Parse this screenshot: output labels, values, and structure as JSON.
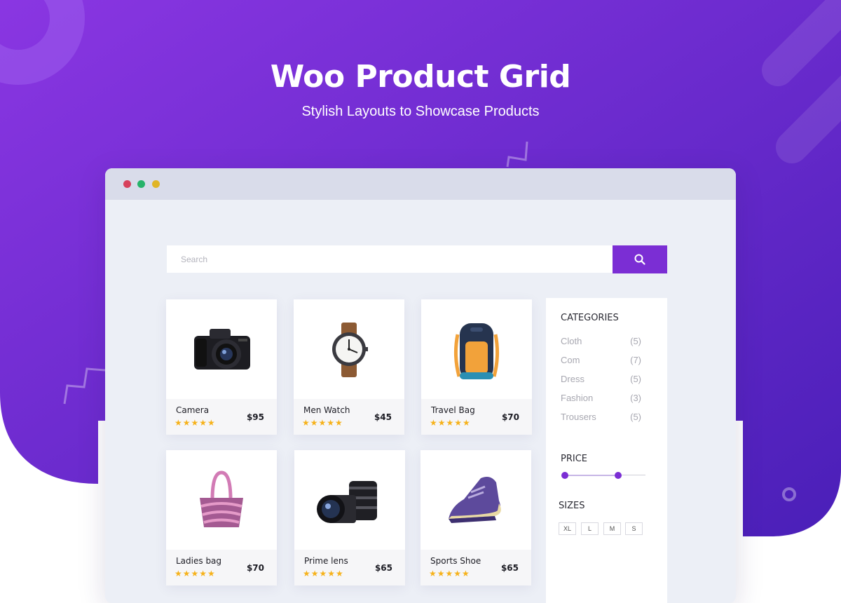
{
  "hero": {
    "title": "Woo Product Grid",
    "subtitle": "Stylish Layouts to Showcase Products"
  },
  "colors": {
    "accent": "#7b2ed4",
    "gradient_start": "#8a36e2",
    "gradient_end": "#4a1fb8",
    "star": "#f6b21b",
    "dot_red": "#d7415c",
    "dot_green": "#27b36a",
    "dot_yellow": "#e0b526"
  },
  "browser": {
    "window_controls": [
      "close-dot",
      "minimize-dot",
      "maximize-dot"
    ]
  },
  "search": {
    "placeholder": "Search",
    "button_icon": "search-icon"
  },
  "products": [
    {
      "name": "Camera",
      "price": "$95",
      "stars": "★★★★★",
      "icon": "camera-image",
      "rating": 5
    },
    {
      "name": "Men Watch",
      "price": "$45",
      "stars": "★★★★★",
      "icon": "watch-image",
      "rating": 5
    },
    {
      "name": "Travel Bag",
      "price": "$70",
      "stars": "★★★★★",
      "icon": "backpack-image",
      "rating": 5
    },
    {
      "name": "Ladies bag",
      "price": "$70",
      "stars": "★★★★★",
      "icon": "handbag-image",
      "rating": 5
    },
    {
      "name": "Prime lens",
      "price": "$65",
      "stars": "★★★★★",
      "icon": "lens-image",
      "rating": 5
    },
    {
      "name": "Sports Shoe",
      "price": "$65",
      "stars": "★★★★★",
      "icon": "shoe-image",
      "rating": 5
    }
  ],
  "sidebar": {
    "categories_heading": "CATEGORIES",
    "categories": [
      {
        "name": "Cloth",
        "count": "(5)"
      },
      {
        "name": "Com",
        "count": "(7)"
      },
      {
        "name": "Dress",
        "count": "(5)"
      },
      {
        "name": "Fashion",
        "count": "(3)"
      },
      {
        "name": "Trousers",
        "count": "(5)"
      }
    ],
    "price_heading": "PRICE",
    "sizes_heading": "SIZES",
    "sizes": [
      "XL",
      "L",
      "M",
      "S"
    ]
  }
}
